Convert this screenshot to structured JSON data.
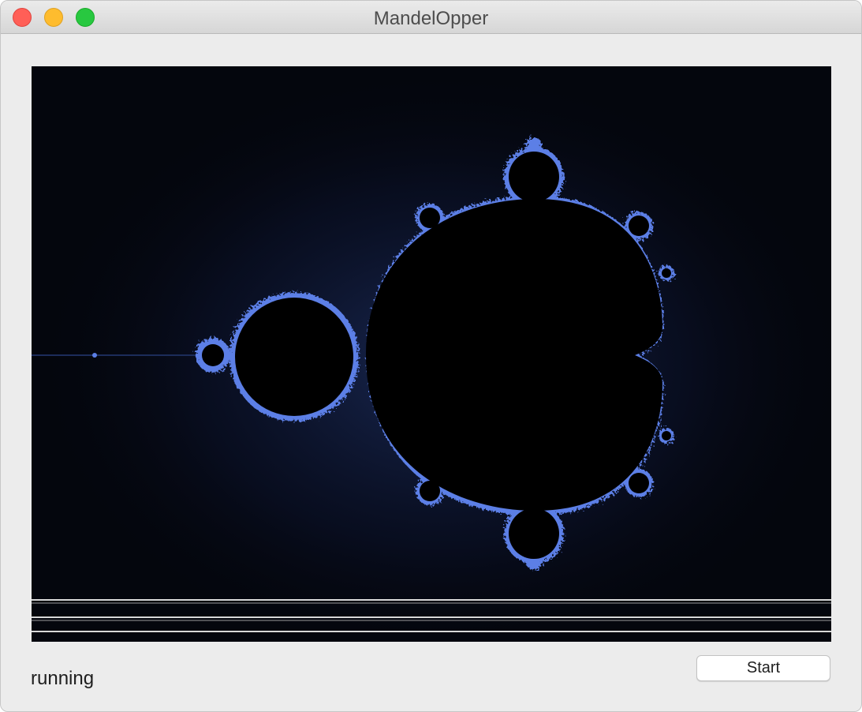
{
  "window": {
    "title": "MandelOpper"
  },
  "status": {
    "text": "running"
  },
  "toolbar": {
    "start_label": "Start"
  },
  "colors": {
    "background": "#04060d",
    "fractal_edge": "#5b7fe6",
    "fractal_glow": "#1c2c5a",
    "set_interior": "#000000"
  }
}
